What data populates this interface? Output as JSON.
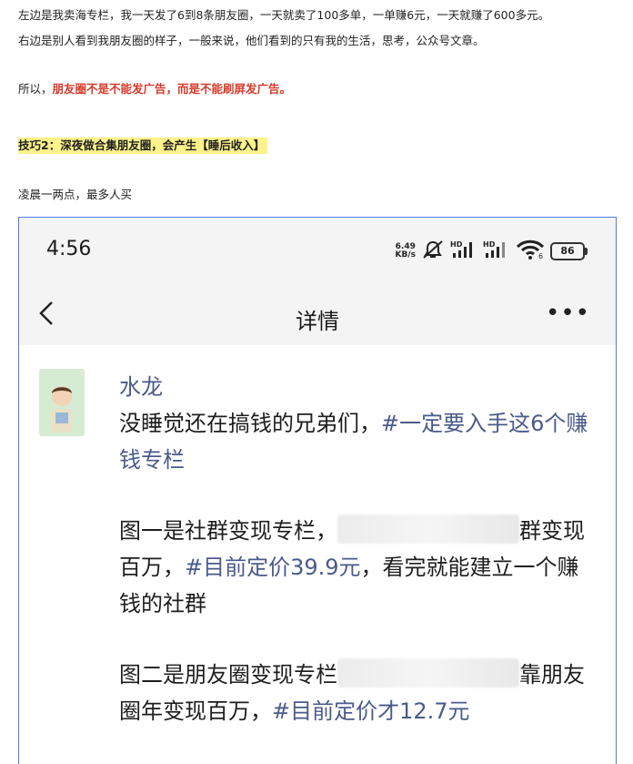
{
  "article": {
    "line1": "左边是我卖海专栏，我一天发了6到8条朋友圈，一天就卖了100多单，一单赚6元，一天就赚了600多元。",
    "line2": "右边是别人看到我朋友圈的样子，一般来说，他们看到的只有我的生活，思考，公众号文章。",
    "line3_prefix": "所以，",
    "line3_red": "朋友圈不是不能发广告，而是不能刷屏发广告。",
    "tip_title": "技巧2：深夜做合集朋友圈，会产生【睡后收入】",
    "line4": "凌晨一两点，最多人买"
  },
  "phone": {
    "time": "4:56",
    "net_speed_value": "6.49",
    "net_speed_unit": "KB/s",
    "signal1_label": "HD",
    "signal2_label": "HD",
    "wifi_sub": "6",
    "battery": "86",
    "nav_title": "详情",
    "back_glyph": "<",
    "more_glyph": "•••",
    "post": {
      "author": "水龙",
      "line1_text": "没睡觉还在搞钱的兄弟们，",
      "line1_tag": "#一定要入手这6个赚钱专栏",
      "para2_a": "图一是社群变现专栏，",
      "para2_b": "群变现百万，",
      "para2_tag": "#目前定价39.9元",
      "para2_c": "，看完就能建立一个赚钱的社群",
      "para3_a": "图二是朋友圈变现专栏",
      "para3_b": "靠朋友圈年变现百万，",
      "para3_tag": "#目前定价才12.7元"
    }
  },
  "colors": {
    "link": "#4a5a8a",
    "red": "#d93a2b",
    "highlight": "#fdf38a",
    "border": "#4d7fe0"
  }
}
